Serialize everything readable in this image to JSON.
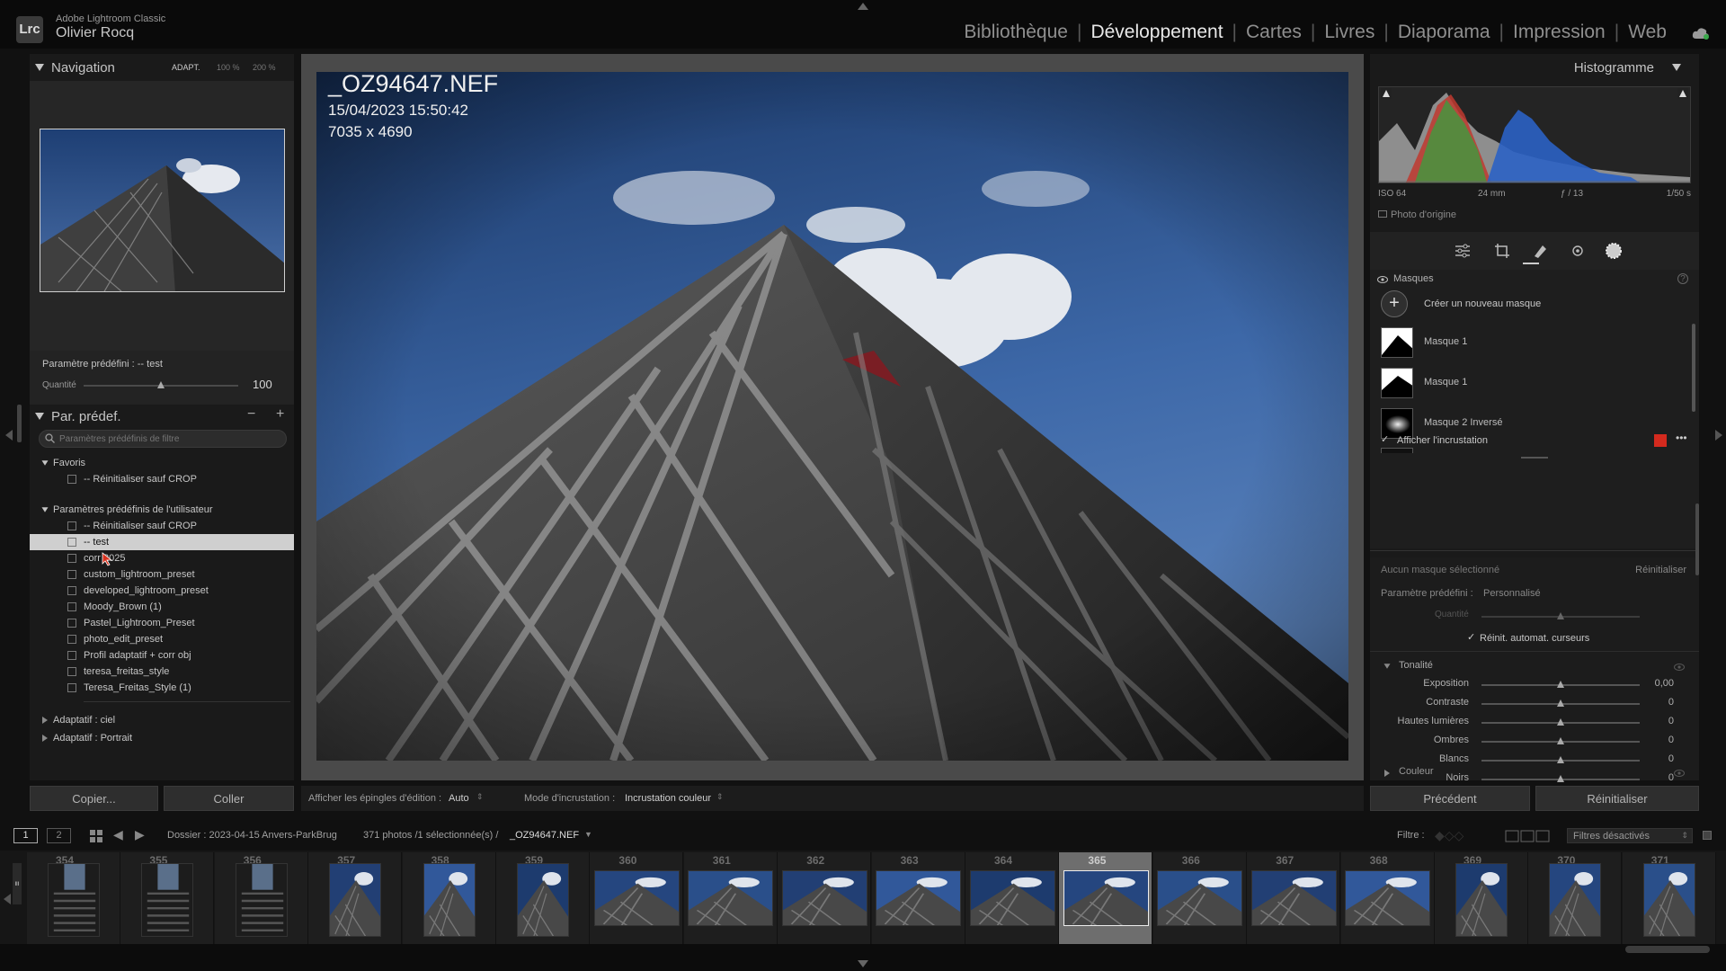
{
  "app": {
    "logo": "Lrc",
    "product": "Adobe Lightroom Classic",
    "user": "Olivier Rocq",
    "modules": [
      "Bibliothèque",
      "Développement",
      "Cartes",
      "Livres",
      "Diaporama",
      "Impression",
      "Web"
    ],
    "active_module": "Développement"
  },
  "navigator": {
    "title": "Navigation",
    "zoom_fit": "ADAPT.",
    "zoom_100": "100 %",
    "zoom_200": "200 %"
  },
  "preset_amount": {
    "label": "Paramètre prédéfini : -- test",
    "amount_label": "Quantité",
    "amount_value": "100",
    "amount_level": 0.5
  },
  "presets": {
    "title": "Par. prédef.",
    "minus": "−",
    "plus": "+",
    "search_placeholder": "Paramètres prédéfinis de filtre",
    "groups": [
      {
        "label": "Favoris",
        "open": true,
        "items": [
          "-- Réinitialiser sauf CROP"
        ]
      },
      {
        "label": "Paramètres prédéfinis de l'utilisateur",
        "open": true,
        "items": [
          "-- Réinitialiser sauf CROP",
          "-- test",
          "corr 2025",
          "custom_lightroom_preset",
          "developed_lightroom_preset",
          "Moody_Brown (1)",
          "Pastel_Lightroom_Preset",
          "photo_edit_preset",
          "Profil adaptatif + corr obj",
          "teresa_freitas_style",
          "Teresa_Freitas_Style (1)"
        ]
      },
      {
        "label": "Adaptatif : ciel",
        "open": false,
        "items": []
      },
      {
        "label": "Adaptatif : Portrait",
        "open": false,
        "items": []
      }
    ],
    "selected": "-- test"
  },
  "left_buttons": {
    "copy": "Copier...",
    "paste": "Coller"
  },
  "photo": {
    "name": "_OZ94647.NEF",
    "date": "15/04/2023 15:50:42",
    "dimensions": "7035 x 4690"
  },
  "center_toolbar": {
    "pins_label": "Afficher les épingles d'édition :",
    "pins_value": "Auto",
    "overlay_label": "Mode d'incrustation :",
    "overlay_value": "Incrustation couleur"
  },
  "histogram": {
    "title": "Histogramme",
    "iso": "ISO 64",
    "focal": "24 mm",
    "aperture": "ƒ / 13",
    "shutter": "1/50 s",
    "original_photo": "Photo d'origine"
  },
  "masks": {
    "title": "Masques",
    "create": "Créer un nouveau masque",
    "items": [
      "Masque 1",
      "Masque 1",
      "Masque 2 Inversé"
    ],
    "show_overlay": "Afficher l'incrustation",
    "overlay_color": "#d42a1e"
  },
  "mask_settings": {
    "none_selected": "Aucun masque sélectionné",
    "reset": "Réinitialiser",
    "preset_label": "Paramètre prédéfini :",
    "preset_value": "Personnalisé",
    "amount_label": "Quantité",
    "auto_reset": "Réinit. automat. curseurs"
  },
  "tone": {
    "title": "Tonalité",
    "sliders": [
      {
        "label": "Exposition",
        "value": "0,00",
        "level": 0.5
      },
      {
        "label": "Contraste",
        "value": "0",
        "level": 0.5
      },
      {
        "label": "Hautes lumières",
        "value": "0",
        "level": 0.5
      },
      {
        "label": "Ombres",
        "value": "0",
        "level": 0.5
      },
      {
        "label": "Blancs",
        "value": "0",
        "level": 0.5
      },
      {
        "label": "Noirs",
        "value": "0",
        "level": 0.5
      }
    ],
    "color_section": "Couleur"
  },
  "right_buttons": {
    "previous": "Précédent",
    "reset": "Réinitialiser"
  },
  "filmstrip_bar": {
    "view1": "1",
    "view2": "2",
    "folder": "Dossier : 2023-04-15 Anvers-ParkBrug",
    "count": "371 photos /1 sélectionnée(s) /",
    "file": "_OZ94647.NEF",
    "filter_label": "Filtre :",
    "filter_value": "Filtres désactivés"
  },
  "filmstrip": {
    "numbers": [
      "354",
      "355",
      "356",
      "357",
      "358",
      "359",
      "360",
      "361",
      "362",
      "363",
      "364",
      "365",
      "366",
      "367",
      "368",
      "369",
      "370",
      "371"
    ],
    "selected": "365"
  }
}
